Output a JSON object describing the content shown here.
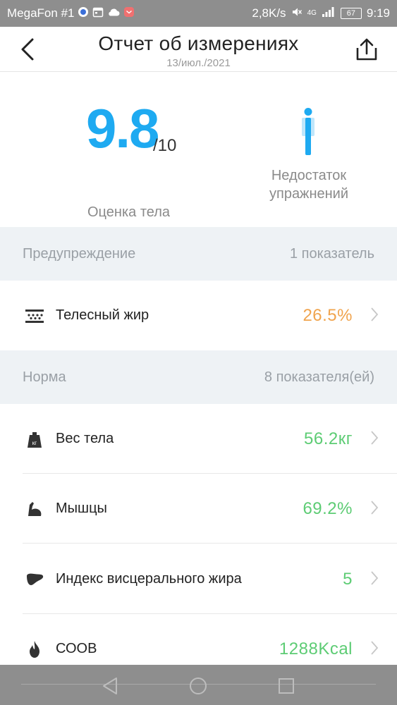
{
  "status_bar": {
    "carrier": "MegaFon #1",
    "speed": "2,8K/s",
    "network": "4G",
    "battery": "67",
    "time": "9:19"
  },
  "header": {
    "title": "Отчет об измерениях",
    "date": "13/июл./2021"
  },
  "score": {
    "value": "9.8",
    "max": "/10",
    "label": "Оценка тела",
    "status_label": "Недостаток упражнений"
  },
  "warning_section": {
    "title": "Предупреждение",
    "count": "1 показатель",
    "items": [
      {
        "label": "Телесный жир",
        "value": "26.5%",
        "icon": "body-fat-icon"
      }
    ]
  },
  "normal_section": {
    "title": "Норма",
    "count": "8 показателя(ей)",
    "items": [
      {
        "label": "Вес тела",
        "value": "56.2кг",
        "icon": "weight-scale-icon"
      },
      {
        "label": "Мышцы",
        "value": "69.2%",
        "icon": "muscle-icon"
      },
      {
        "label": "Индекс висцерального жира",
        "value": "5",
        "icon": "liver-icon"
      },
      {
        "label": "СООВ",
        "value": "1288Kcal",
        "icon": "flame-icon"
      }
    ]
  },
  "colors": {
    "accent": "#1eaaf1",
    "warning": "#f0a44e",
    "normal": "#5dcc74"
  }
}
